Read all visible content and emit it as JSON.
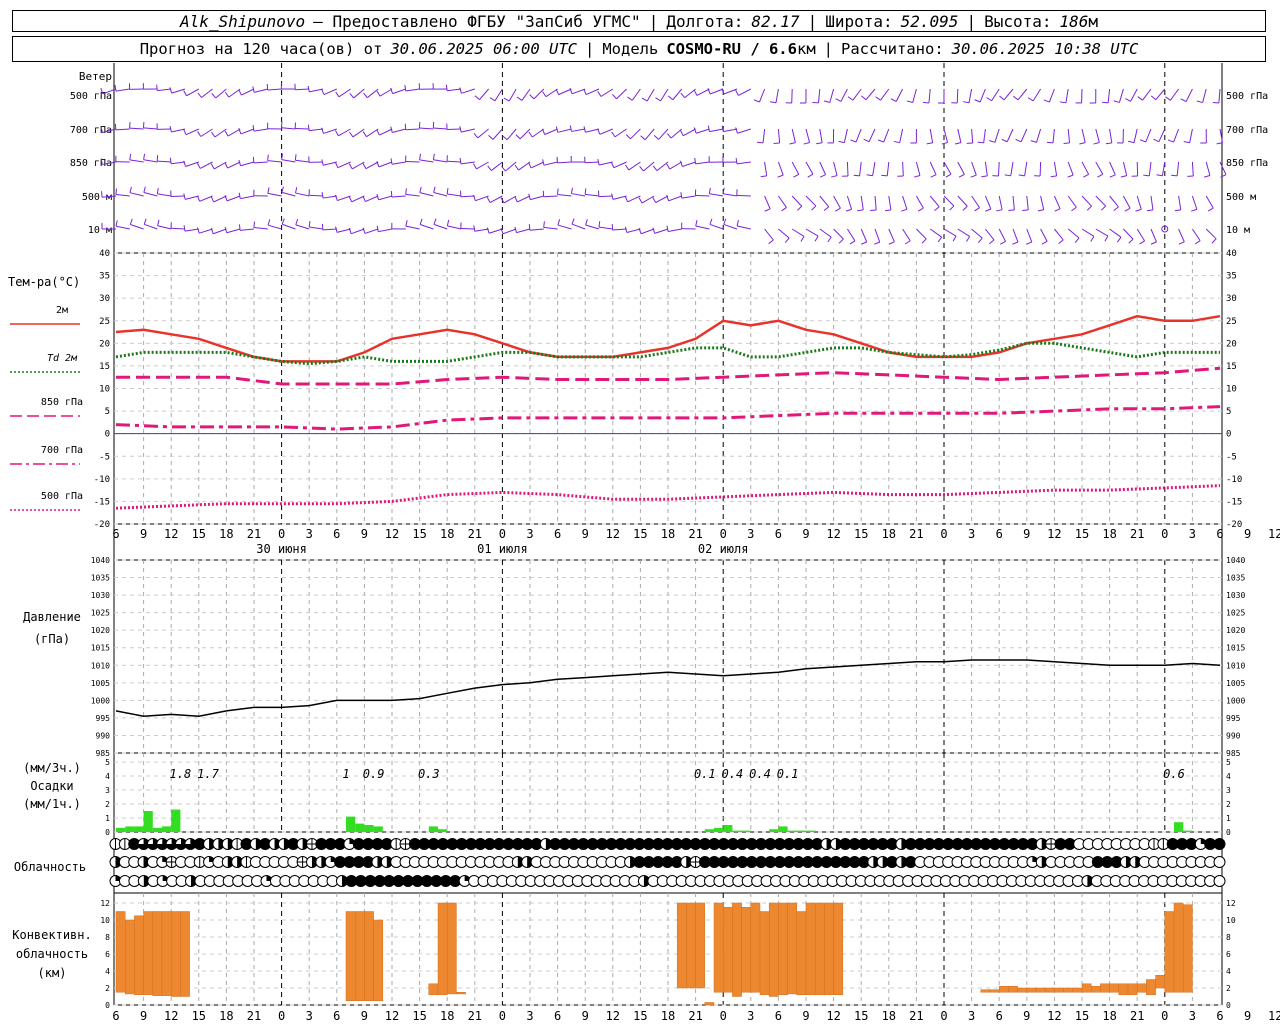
{
  "header": {
    "station": "Alk_Shipunovo",
    "provider": "– Предоставлено ФГБУ \"ЗапСиб УГМС\"",
    "lon_label": "Долгота:",
    "lon_value": "82.17",
    "lat_label": "Широта:",
    "lat_value": "52.095",
    "alt_label": "Высота:",
    "alt_value": "186",
    "alt_unit": "м",
    "forecast_label": "Прогноз на 120 часа(ов) от",
    "forecast_start": "30.06.2025 06:00 UTC",
    "model_label": "Модель",
    "model_name": "COSMO-RU / 6.6",
    "model_unit": "км",
    "computed_label": "Рассчитано:",
    "computed_value": "30.06.2025 10:38 UTC"
  },
  "colors": {
    "t2m": "#e8332b",
    "td2m": "#1a7a1a",
    "t850": "#e0187a",
    "t700": "#e0187a",
    "t500": "#e0187a",
    "wind": "#7a22d8",
    "zero_line": "#2b3bd8",
    "precip": "#33dd22",
    "conv": "#ee8830",
    "pressure": "#000000"
  },
  "wind_panel": {
    "title": "Ветер",
    "levels": [
      "500 гПа",
      "700 гПа",
      "850 гПа",
      "500 м",
      "10 м"
    ]
  },
  "temp_panel": {
    "title": "Тем-ра(°С)",
    "legend": [
      {
        "label": "2м",
        "style": "solid",
        "color_key": "t2m"
      },
      {
        "label": "Td 2м",
        "style": "dotted",
        "color_key": "td2m"
      },
      {
        "label": "850 гПа",
        "style": "dashed",
        "color_key": "t850"
      },
      {
        "label": "700 гПа",
        "style": "dashdot",
        "color_key": "t700"
      },
      {
        "label": "500 гПа",
        "style": "dotted",
        "color_key": "t500"
      }
    ],
    "y_ticks": [
      40,
      35,
      30,
      25,
      20,
      15,
      10,
      5,
      0,
      -5,
      -10,
      -15,
      -20
    ]
  },
  "time_axis": {
    "hour_labels": [
      "6",
      "9",
      "12",
      "15",
      "18",
      "21",
      "0",
      "3",
      "6",
      "9",
      "12",
      "15",
      "18",
      "21",
      "0",
      "3",
      "6",
      "9",
      "12",
      "15",
      "18",
      "21",
      "0",
      "3",
      "6",
      "9",
      "12",
      "15",
      "18",
      "21",
      "0",
      "3",
      "6",
      "9",
      "12",
      "15",
      "18",
      "21",
      "0",
      "3",
      "6",
      "9",
      "12"
    ],
    "dates": [
      "30 июня",
      "01 июля",
      "02 июля"
    ]
  },
  "pressure_panel": {
    "title_1": "Давление",
    "title_2": "(гПа)",
    "y_ticks": [
      1040,
      1035,
      1030,
      1025,
      1020,
      1015,
      1010,
      1005,
      1000,
      995,
      990,
      985
    ]
  },
  "precip_panel": {
    "title_1": "(мм/3ч.)",
    "title_2": "Осадки",
    "title_3": "(мм/1ч.)",
    "y_ticks": [
      5,
      4,
      3,
      2,
      1,
      0
    ],
    "sums": [
      {
        "hour": 7,
        "label": "1.8"
      },
      {
        "hour": 10,
        "label": "1.7"
      },
      {
        "hour": 25,
        "label": "1"
      },
      {
        "hour": 28,
        "label": "0.9"
      },
      {
        "hour": 34,
        "label": "0.3"
      },
      {
        "hour": 64,
        "label": "0.1"
      },
      {
        "hour": 67,
        "label": "0.4"
      },
      {
        "hour": 70,
        "label": "0.4"
      },
      {
        "hour": 73,
        "label": "0.1"
      },
      {
        "hour": 115,
        "label": "0.6"
      }
    ]
  },
  "cloud_panel": {
    "title": "Облачность",
    "rows": [
      "ppbddddddbhhhpbhbhhbhfbbbqbbbbpfbbbbbbbbbbbbbbhbbbbbbbbbbbbbbbbbbbbbbbbbbbbbhhbbbbbbhbbbbbbbbbbbbbbhfbbooooooooppbbbqbb",
      "hoohoqfoopqohhpooooofhhqbbbbhhooooooooooooohhoooooooooohbbbbbhfbbbbbbbbbbbbbbbbbbhhbhbooooooooooooqhooooobbbhhooooooooo",
      "qoohoqoohoooooooqooooooohbbbbbbbbbbbbqoooooooooooooooooohoooooooooooooooooooooooooooooooooooooooooooooohoooooooooooooo"
    ]
  },
  "conv_panel": {
    "title_1": "Конвективн.",
    "title_2": "облачность",
    "title_3": "(км)",
    "y_ticks": [
      12,
      10,
      8,
      6,
      4,
      2,
      0
    ]
  },
  "chart_data": [
    {
      "type": "line",
      "title": "Тем-ра(°С)",
      "x_unit": "hours since 30.06.2025 06:00 UTC",
      "ylim": [
        -20,
        40
      ],
      "series": [
        {
          "name": "2м",
          "x": [
            0,
            3,
            6,
            9,
            12,
            15,
            18,
            21,
            24,
            27,
            30,
            33,
            36,
            39,
            42,
            45,
            48,
            51,
            54,
            57,
            60,
            63,
            66,
            69,
            72,
            75,
            78,
            81,
            84,
            87,
            90,
            93,
            96,
            99,
            102,
            105,
            108,
            111,
            114,
            117,
            120
          ],
          "y": [
            22.5,
            23,
            22,
            21,
            19,
            17,
            16,
            16,
            16,
            18,
            21,
            22,
            23,
            22,
            20,
            18,
            17,
            17,
            17,
            18,
            19,
            21,
            25,
            24,
            25,
            23,
            22,
            20,
            18,
            17,
            17,
            17,
            18,
            20,
            21,
            22,
            24,
            26,
            25,
            25,
            26
          ]
        },
        {
          "name": "Td 2м",
          "x": [
            0,
            3,
            6,
            9,
            12,
            15,
            18,
            21,
            24,
            27,
            30,
            33,
            36,
            39,
            42,
            45,
            48,
            51,
            54,
            57,
            60,
            63,
            66,
            69,
            72,
            75,
            78,
            81,
            84,
            87,
            90,
            93,
            96,
            99,
            102,
            105,
            108,
            111,
            114,
            117,
            120
          ],
          "y": [
            17,
            18,
            18,
            18,
            18,
            17,
            16,
            15.5,
            16,
            17,
            16,
            16,
            16,
            17,
            18,
            18,
            17,
            17,
            17,
            17,
            18,
            19,
            19,
            17,
            17,
            18,
            19,
            19,
            18,
            17.5,
            17,
            17.5,
            18.5,
            20,
            20,
            19,
            18,
            17,
            18,
            18,
            18
          ]
        },
        {
          "name": "850 гПа",
          "x": [
            0,
            6,
            12,
            18,
            24,
            30,
            36,
            42,
            48,
            54,
            60,
            66,
            72,
            78,
            84,
            90,
            96,
            102,
            108,
            114,
            120
          ],
          "y": [
            12.5,
            12.5,
            12.5,
            11,
            11,
            11,
            12,
            12.5,
            12,
            12,
            12,
            12.5,
            13,
            13.5,
            13,
            12.5,
            12,
            12.5,
            13,
            13.5,
            14.5
          ]
        },
        {
          "name": "700 гПа",
          "x": [
            0,
            6,
            12,
            18,
            24,
            30,
            36,
            42,
            48,
            54,
            60,
            66,
            72,
            78,
            84,
            90,
            96,
            102,
            108,
            114,
            120
          ],
          "y": [
            2,
            1.5,
            1.5,
            1.5,
            1,
            1.5,
            3,
            3.5,
            3.5,
            3.5,
            3.5,
            3.5,
            4,
            4.5,
            4.5,
            4.5,
            4.5,
            5,
            5.5,
            5.5,
            6
          ]
        },
        {
          "name": "500 гПа",
          "x": [
            0,
            6,
            12,
            18,
            24,
            30,
            36,
            42,
            48,
            54,
            60,
            66,
            72,
            78,
            84,
            90,
            96,
            102,
            108,
            114,
            120
          ],
          "y": [
            -16.5,
            -16,
            -15.5,
            -15.5,
            -15.5,
            -15,
            -13.5,
            -13,
            -13.5,
            -14.5,
            -14.5,
            -14,
            -13.5,
            -13,
            -13.5,
            -13.5,
            -13,
            -12.5,
            -12.5,
            -12,
            -11.5
          ]
        }
      ]
    },
    {
      "type": "line",
      "title": "Давление (гПа)",
      "ylim": [
        985,
        1040
      ],
      "series": [
        {
          "name": "Давление",
          "x": [
            0,
            3,
            6,
            9,
            12,
            15,
            18,
            21,
            24,
            27,
            30,
            33,
            36,
            39,
            42,
            45,
            48,
            51,
            54,
            57,
            60,
            63,
            66,
            69,
            72,
            75,
            78,
            81,
            84,
            87,
            90,
            93,
            96,
            99,
            102,
            105,
            108,
            111,
            114,
            117,
            120
          ],
          "y": [
            997,
            995.5,
            996,
            995.5,
            997,
            998,
            998,
            998.5,
            1000,
            1000,
            1000,
            1000.5,
            1002,
            1003.5,
            1004.5,
            1005,
            1006,
            1006.5,
            1007,
            1007.5,
            1008,
            1007.5,
            1007,
            1007.5,
            1008,
            1009,
            1009.5,
            1010,
            1010.5,
            1011,
            1011,
            1011.5,
            1011.5,
            1011.5,
            1011,
            1010.5,
            1010,
            1010,
            1010,
            1010.5,
            1010
          ]
        }
      ]
    },
    {
      "type": "bar",
      "title": "Осадки (мм/1ч.)",
      "ylim": [
        0,
        5
      ],
      "series": [
        {
          "name": "мм/1ч",
          "x": [
            0,
            1,
            2,
            3,
            4,
            5,
            6,
            25,
            26,
            27,
            28,
            34,
            35,
            64,
            65,
            66,
            67,
            68,
            71,
            72,
            73,
            74,
            75,
            115,
            116
          ],
          "y": [
            0.3,
            0.4,
            0.4,
            1.5,
            0.3,
            0.4,
            1.6,
            1.1,
            0.6,
            0.5,
            0.4,
            0.4,
            0.2,
            0.2,
            0.3,
            0.5,
            0.1,
            0.1,
            0.2,
            0.4,
            0.1,
            0.1,
            0.1,
            0.7,
            0.1
          ]
        }
      ]
    },
    {
      "type": "bar",
      "title": "Конвективн. облачность (км)",
      "ylim": [
        0,
        12
      ],
      "series": [
        {
          "name": "база",
          "x": [
            0,
            1,
            2,
            3,
            4,
            5,
            6,
            7,
            25,
            26,
            27,
            28,
            34,
            35,
            36,
            37,
            61,
            62,
            63,
            64,
            65,
            66,
            67,
            68,
            69,
            70,
            71,
            72,
            73,
            74,
            75,
            76,
            77,
            78,
            80,
            81,
            82,
            83,
            84,
            85,
            86,
            87,
            88,
            89,
            90,
            91,
            92,
            93,
            94,
            95,
            96,
            97,
            98,
            99,
            100,
            101,
            102,
            103,
            104,
            105,
            106,
            107,
            108,
            109,
            110,
            111,
            112,
            113,
            114,
            115,
            116
          ],
          "y": [
            1.5,
            1.3,
            1.2,
            1.2,
            1.1,
            1.1,
            1,
            1,
            0.5,
            0.5,
            0.5,
            0.5,
            1.2,
            1.2,
            1.3,
            1.3,
            2,
            2,
            2,
            0,
            1.5,
            1.5,
            1,
            1.5,
            1.5,
            1.2,
            1,
            1.2,
            1.3,
            1.2,
            1.2,
            1.2,
            1.2,
            1.2,
            0,
            0,
            0,
            0,
            0,
            0,
            0,
            0,
            0,
            0,
            0,
            0,
            0,
            0,
            1.5,
            1.5,
            1.5,
            1.5,
            1.5,
            1.5,
            1.5,
            1.5,
            1.5,
            1.5,
            1.5,
            1.5,
            1.5,
            1.5,
            1.5,
            1.2,
            1.2,
            1.5,
            1.2,
            2,
            1.5,
            1.5,
            1.5
          ]
        },
        {
          "name": "вершина",
          "x": [
            0,
            1,
            2,
            3,
            4,
            5,
            6,
            7,
            25,
            26,
            27,
            28,
            34,
            35,
            36,
            37,
            61,
            62,
            63,
            64,
            65,
            66,
            67,
            68,
            69,
            70,
            71,
            72,
            73,
            74,
            75,
            76,
            77,
            78,
            80,
            81,
            82,
            83,
            84,
            85,
            86,
            87,
            88,
            89,
            90,
            91,
            92,
            93,
            94,
            95,
            96,
            97,
            98,
            99,
            100,
            101,
            102,
            103,
            104,
            105,
            106,
            107,
            108,
            109,
            110,
            111,
            112,
            113,
            114,
            115,
            116
          ],
          "y": [
            11,
            10,
            10.5,
            11,
            11,
            11,
            11,
            11,
            11,
            11,
            11,
            10,
            2.5,
            12,
            12,
            1.5,
            12,
            12,
            12,
            0.3,
            12,
            11.5,
            12,
            11.5,
            12,
            11,
            12,
            12,
            12,
            11,
            12,
            12,
            12,
            12,
            0,
            0,
            0,
            0,
            0,
            0,
            0,
            0,
            0,
            0,
            0,
            0,
            0,
            0,
            1.8,
            1.8,
            2.2,
            2.2,
            2,
            2,
            2,
            2,
            2,
            2,
            2,
            2.5,
            2.2,
            2.5,
            2.5,
            2.5,
            2.5,
            2.5,
            3,
            3.5,
            11,
            12,
            11.8
          ]
        }
      ]
    }
  ]
}
